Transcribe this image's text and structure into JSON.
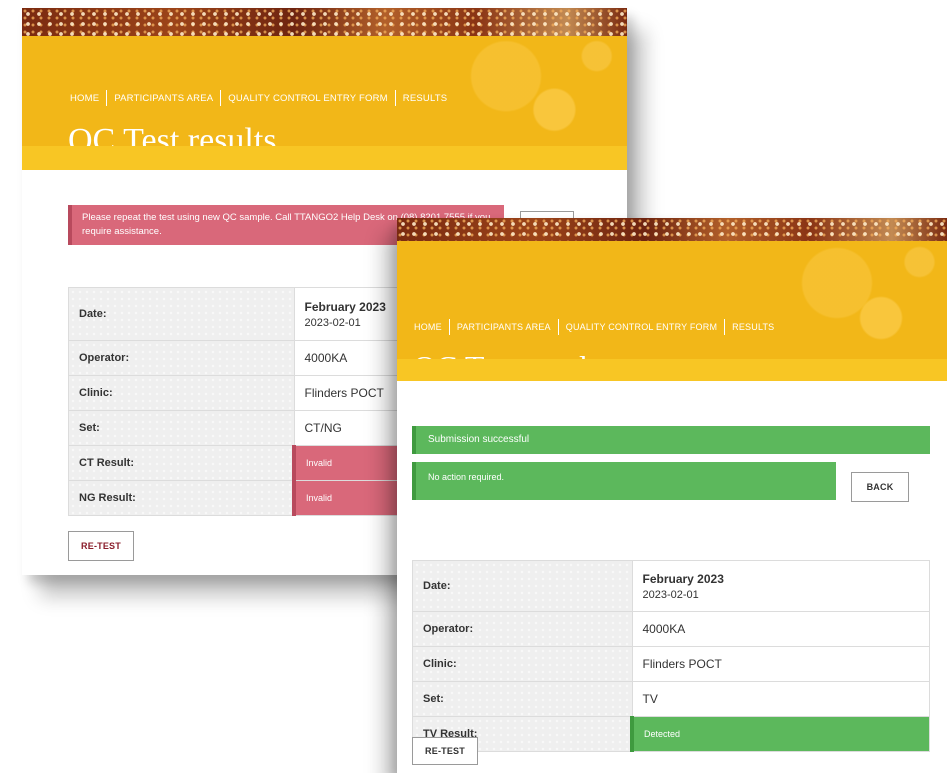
{
  "back_screen": {
    "breadcrumb": [
      "HOME",
      "PARTICIPANTS AREA",
      "QUALITY CONTROL ENTRY FORM",
      "RESULTS"
    ],
    "title": "QC Test results",
    "alert": "Please repeat the test using new QC sample. Call TTANGO2 Help Desk on (08) 8201 7555 if you require assistance.",
    "back_button": "",
    "rows": {
      "date_label": "Date:",
      "date_month": "February 2023",
      "date_value": "2023-02-01",
      "operator_label": "Operator:",
      "operator_value": "4000KA",
      "clinic_label": "Clinic:",
      "clinic_value": "Flinders POCT",
      "set_label": "Set:",
      "set_value": "CT/NG",
      "ct_label": "CT Result:",
      "ct_value": "Invalid",
      "ng_label": "NG Result:",
      "ng_value": "Invalid"
    },
    "retest_button": "RE-TEST"
  },
  "front_screen": {
    "breadcrumb": [
      "HOME",
      "PARTICIPANTS AREA",
      "QUALITY CONTROL ENTRY FORM",
      "RESULTS"
    ],
    "title": "QC Test results",
    "alert_success": "Submission successful",
    "alert_info": "No action required.",
    "back_button": "BACK",
    "rows": {
      "date_label": "Date:",
      "date_month": "February 2023",
      "date_value": "2023-02-01",
      "operator_label": "Operator:",
      "operator_value": "4000KA",
      "clinic_label": "Clinic:",
      "clinic_value": "Flinders POCT",
      "set_label": "Set:",
      "set_value": "TV",
      "tv_label": "TV Result:",
      "tv_value": "Detected"
    },
    "retest_button": "RE-TEST"
  },
  "colors": {
    "banner_yellow": "#f2b718",
    "invalid_red": "#d9687a",
    "success_green": "#5cb85c",
    "button_text": "#8a1c2a"
  }
}
